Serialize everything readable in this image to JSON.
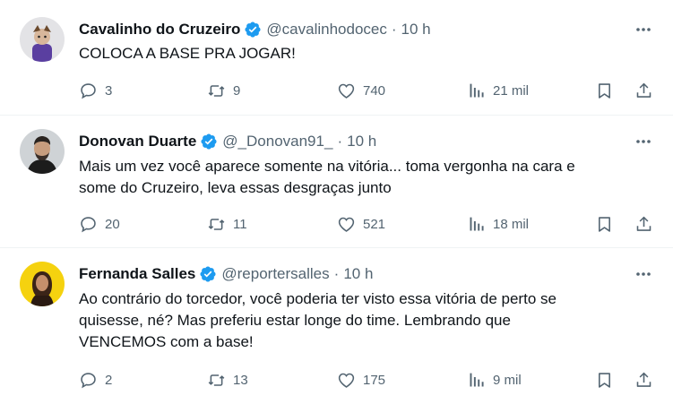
{
  "tweets": [
    {
      "name": "Cavalinho do Cruzeiro",
      "handle": "@cavalinhodocec",
      "dot": "·",
      "time": "10 h",
      "text": [
        "COLOCA A BASE PRA JOGAR!"
      ],
      "replies": "3",
      "retweets": "9",
      "likes": "740",
      "views": "21 mil",
      "avatar_colors": {
        "bg": "#e3e3e6",
        "fg": "#5a3fa0"
      }
    },
    {
      "name": "Donovan Duarte",
      "handle": "@_Donovan91_",
      "dot": "·",
      "time": "10 h",
      "text": [
        "Mais um vez você aparece somente na vitória... toma vergonha na cara e",
        "some do Cruzeiro, leva essas desgraças junto"
      ],
      "replies": "20",
      "retweets": "11",
      "likes": "521",
      "views": "18 mil",
      "avatar_colors": {
        "bg": "#cfd3d6",
        "fg": "#1c1c1c"
      }
    },
    {
      "name": "Fernanda Salles",
      "handle": "@reportersalles",
      "dot": "·",
      "time": "10 h",
      "text": [
        "Ao contrário do torcedor, você poderia ter visto essa vitória de perto se",
        "quisesse, né? Mas preferiu estar longe do time. Lembrando que",
        "VENCEMOS com a base!"
      ],
      "replies": "2",
      "retweets": "13",
      "likes": "175",
      "views": "9 mil",
      "avatar_colors": {
        "bg": "#f5d20f",
        "fg": "#2a1a12"
      }
    }
  ],
  "icons": {
    "verified": "verified-badge-icon",
    "more": "more-options-icon",
    "reply": "reply-icon",
    "retweet": "retweet-icon",
    "like": "heart-icon",
    "views": "views-chart-icon",
    "bookmark": "bookmark-icon",
    "share": "share-icon"
  },
  "colors": {
    "verified": "#1d9bf0",
    "secondary_text": "#536471",
    "primary_text": "#0f1419"
  }
}
